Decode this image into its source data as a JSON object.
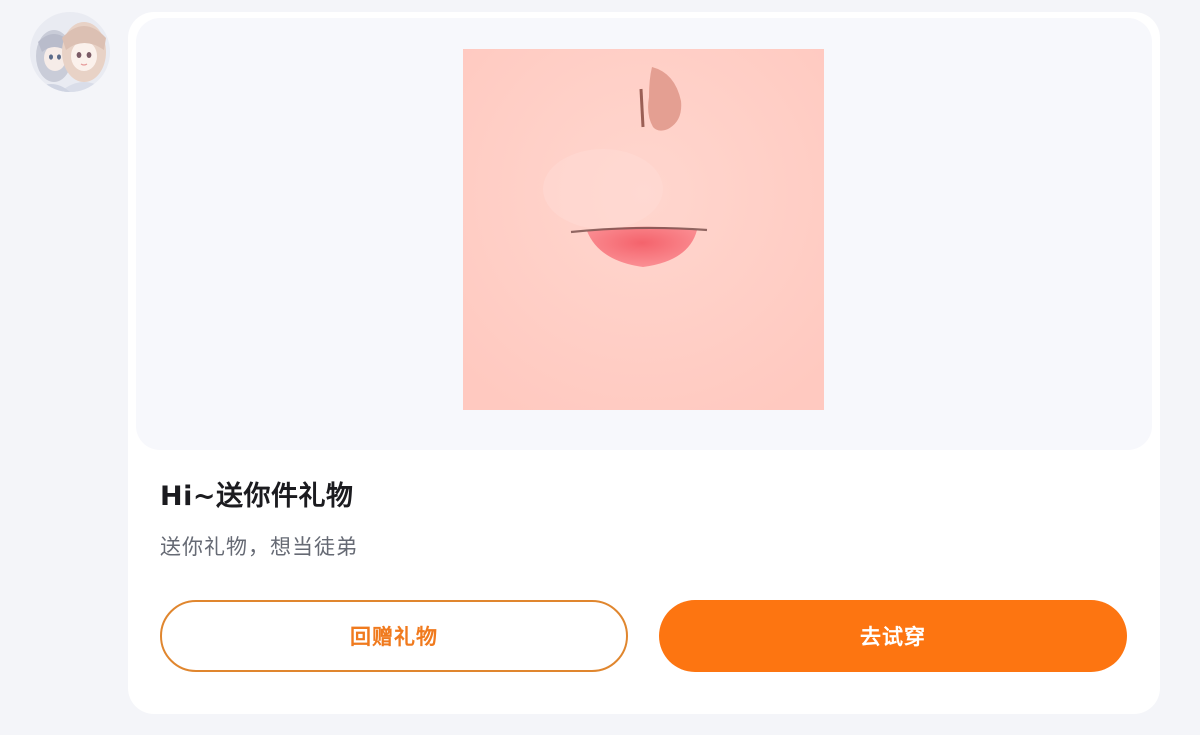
{
  "avatar": {
    "icon": "anime-girl-avatar"
  },
  "gift_card": {
    "preview_image": "lips-makeup-icon",
    "title": "Hi~送你件礼物",
    "message": "送你礼物，想当徒弟",
    "buttons": {
      "return_gift_label": "回赠礼物",
      "try_on_label": "去试穿"
    },
    "colors": {
      "accent": "#fd7511",
      "outline": "#e0862e",
      "skin": "#ffcfc6",
      "lips": "#f56b73"
    }
  }
}
